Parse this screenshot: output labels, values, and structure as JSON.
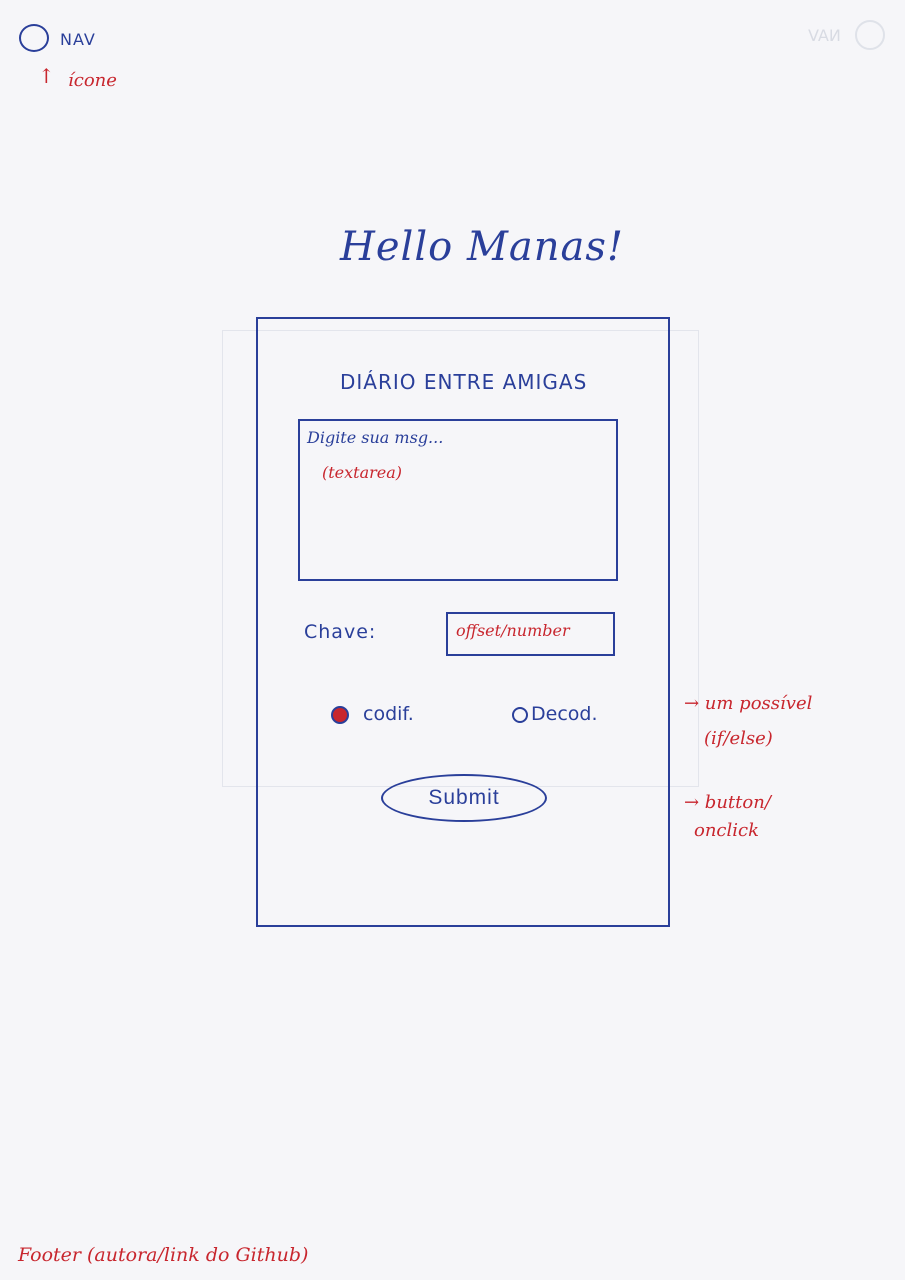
{
  "nav": {
    "label": "NAV",
    "icon_arrow": "↑",
    "icon_note": "ícone",
    "ghost_label": "NAV"
  },
  "title": "Hello Manas!",
  "card": {
    "title": "DIÁRIO ENTRE AMIGAS",
    "textarea": {
      "placeholder": "Digite sua msg...",
      "note": "(textarea)"
    },
    "key": {
      "label": "Chave:",
      "note": "offset/number"
    },
    "radios": [
      {
        "label": "codif.",
        "selected": true
      },
      {
        "label": "Decod.",
        "selected": false
      }
    ],
    "radio_note": {
      "line1": "→ um possível",
      "line2": "(if/else)"
    },
    "submit_label": "Submit",
    "submit_note": {
      "line1": "→ button/",
      "line2": "onclick"
    }
  },
  "footer_note": "Footer (autora/link do Github)",
  "colors": {
    "ink_blue": "#2a3f9a",
    "ink_red": "#c8262e",
    "paper": "#f6f6f9"
  }
}
